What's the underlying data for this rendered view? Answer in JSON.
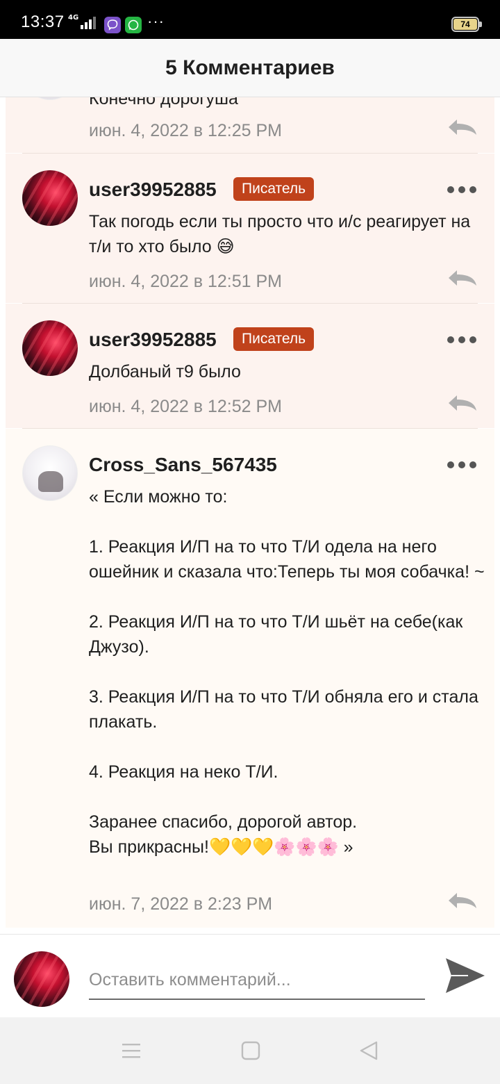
{
  "status_bar": {
    "time": "13:37",
    "network": "4G",
    "battery": "74"
  },
  "header": {
    "title": "5 Комментариев"
  },
  "comments": [
    {
      "body": "Конечно дорогуша",
      "timestamp": "июн. 4, 2022 в 12:25 PM"
    },
    {
      "username": "user39952885",
      "badge": "Писатель",
      "body": "Так погодь если ты просто что и/с реагирует на т/и то хто было 😅",
      "timestamp": "июн. 4, 2022 в 12:51 PM"
    },
    {
      "username": "user39952885",
      "badge": "Писатель",
      "body": "Долбаный т9 было",
      "timestamp": "июн. 4, 2022 в 12:52 PM"
    },
    {
      "username": "Cross_Sans_567435",
      "body": "« Если можно то:\n\n1. Реакция И/П на то что Т/И одела на него ошейник и сказала что:Теперь ты моя собачка! ~\n\n2. Реакция И/П на то что Т/И шьёт на себе(как Джузо).\n\n3. Реакция И/П на то что Т/И обняла его и стала плакать.\n\n4. Реакция на неко Т/И.\n\nЗаранее спасибо, дорогой автор.\nВы прикрасны!💛💛💛🌸🌸🌸 »",
      "timestamp": "июн. 7, 2022 в 2:23 PM"
    }
  ],
  "comment_input": {
    "placeholder": "Оставить комментарий..."
  },
  "colors": {
    "badge": "#c0421b",
    "reply_bg": "#fdf3ef",
    "top_bg": "#fffaf5"
  }
}
